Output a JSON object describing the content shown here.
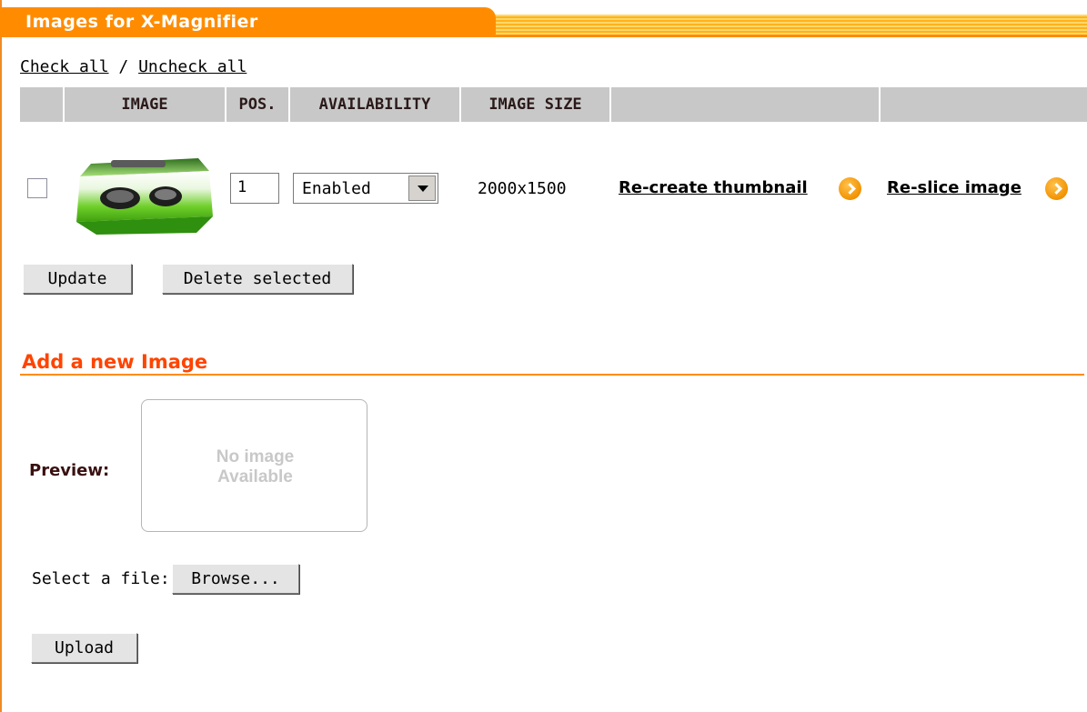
{
  "header": {
    "title": "Images for X-Magnifier"
  },
  "check_links": {
    "check_all": "Check all",
    "separator": "/",
    "uncheck_all": "Uncheck all"
  },
  "table": {
    "columns": [
      "",
      "IMAGE",
      "POS.",
      "AVAILABILITY",
      "IMAGE SIZE",
      "",
      ""
    ],
    "rows": [
      {
        "checked": false,
        "image_icon": "product-thumbnail-green-cube-icon",
        "position": "1",
        "availability": "Enabled",
        "image_size": "2000x1500",
        "recreate_label": "Re-create thumbnail",
        "reslice_label": "Re-slice image"
      }
    ]
  },
  "actions": {
    "update": "Update",
    "delete_selected": "Delete selected"
  },
  "add_image": {
    "title": "Add a new Image",
    "preview_label": "Preview:",
    "no_image_line1": "No image",
    "no_image_line2": "Available",
    "select_file_label": "Select a file:",
    "browse": "Browse...",
    "upload": "Upload"
  },
  "colors": {
    "accent": "#ff8c00",
    "section_title": "#ff4400",
    "table_header_bg": "#c8c8c8"
  }
}
